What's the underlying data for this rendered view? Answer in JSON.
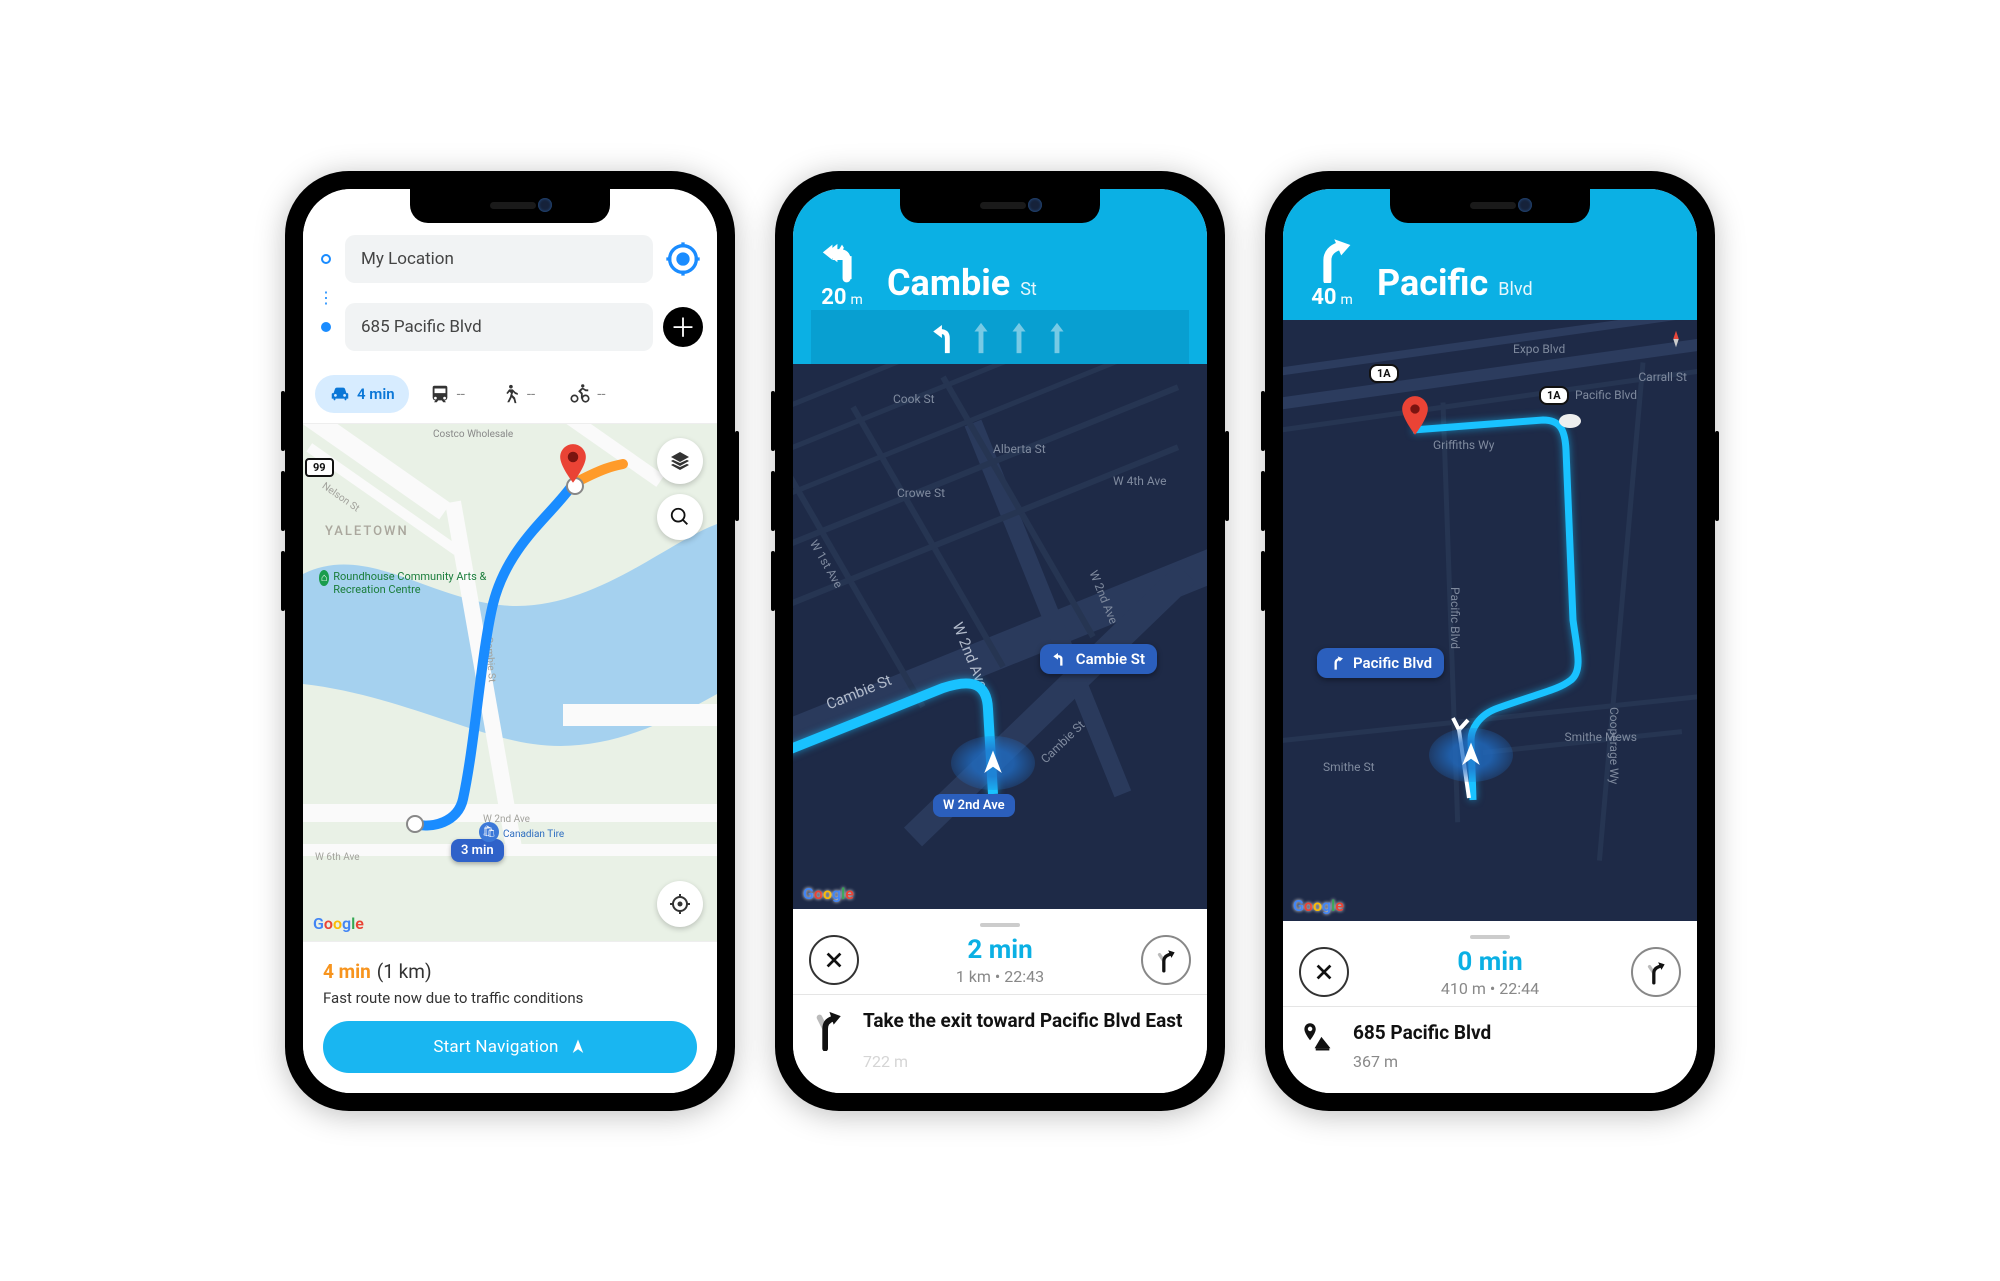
{
  "phone1": {
    "origin_label": "My Location",
    "destination_label": "685 Pacific Blvd",
    "tabs": {
      "drive": "4 min",
      "transit": "--",
      "walk": "--",
      "bike": "--"
    },
    "map": {
      "district": "YALETOWN",
      "poi1": "Roundhouse Community Arts & Recreation Centre",
      "poi_truncated": "Costco Wholesale",
      "canadian_tire": "Canadian Tire",
      "street_nelson": "Nelson St",
      "street_cambie": "Cambie St",
      "street_w2nd": "W 2nd Ave",
      "street_w6th": "W 6th Ave",
      "route_badge": "3 min",
      "hw_shield": "99"
    },
    "bottom": {
      "eta": "4 min",
      "distance": "(1 km)",
      "message": "Fast route now due to traffic conditions",
      "cta": "Start Navigation"
    },
    "attribution": "Google"
  },
  "phone2": {
    "header": {
      "distance_value": "20",
      "distance_unit": "m",
      "street_name": "Cambie",
      "street_suffix": "St"
    },
    "callouts": {
      "turn": "Cambie St",
      "current": "W 2nd Ave"
    },
    "map_labels": {
      "cook": "Cook St",
      "w1st": "W 1st Ave",
      "alberta": "Alberta St",
      "crowe": "Crowe St",
      "cambie_big": "Cambie St",
      "cambie_small": "Cambie St",
      "w2nd": "W 2nd Ave",
      "w2nd_b": "W 2nd Ave",
      "w4th": "W 4th Ave"
    },
    "bottom": {
      "eta": "2 min",
      "distance": "1 km",
      "arrival": "22:43"
    },
    "step": {
      "text": "Take the exit toward Pacific Blvd East",
      "sub": "722 m"
    },
    "attribution": "Google"
  },
  "phone3": {
    "header": {
      "distance_value": "40",
      "distance_unit": "m",
      "street_name": "Pacific",
      "street_suffix": "Blvd"
    },
    "callouts": {
      "turn": "Pacific Blvd"
    },
    "map_labels": {
      "expo": "Expo Blvd",
      "pacific": "Pacific Blvd",
      "griffiths": "Griffiths Wy",
      "carrall": "Carrall St",
      "smithe": "Smithe St",
      "smithe_mews": "Smithe Mews",
      "cooperage": "Cooperage Wy",
      "pacific_vert": "Pacific Blvd",
      "shield": "1A"
    },
    "bottom": {
      "eta": "0 min",
      "distance": "410 m",
      "arrival": "22:44"
    },
    "step": {
      "text": "685 Pacific Blvd",
      "sub": "367 m"
    },
    "attribution": "Google"
  }
}
